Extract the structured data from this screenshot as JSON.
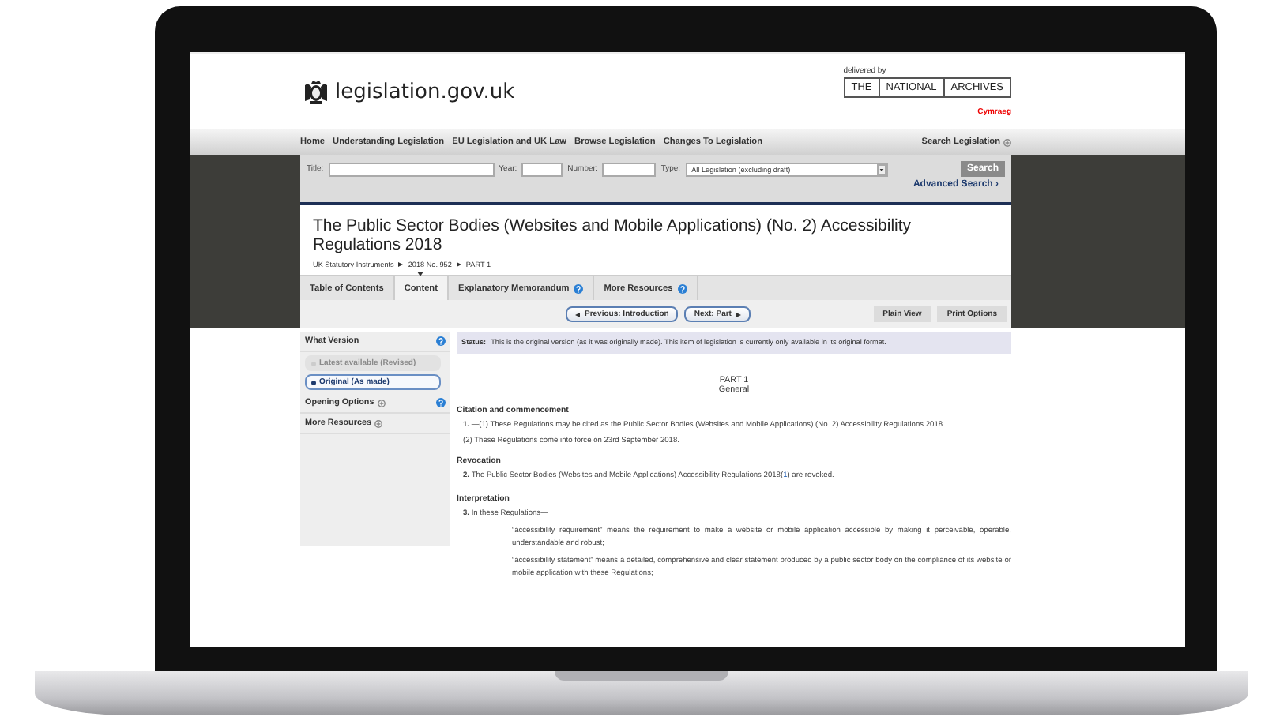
{
  "header": {
    "logo_text": "legislation.gov.uk",
    "delivered_by": "delivered by",
    "archives": [
      "THE",
      "NATIONAL",
      "ARCHIVES"
    ],
    "language_link": "Cymraeg"
  },
  "nav": {
    "items": [
      "Home",
      "Understanding Legislation",
      "EU Legislation and UK Law",
      "Browse Legislation",
      "Changes To Legislation"
    ],
    "search_toggle": "Search Legislation"
  },
  "search": {
    "fields": [
      {
        "label": "Title:",
        "kind": "wide"
      },
      {
        "label": "Year:",
        "kind": "short"
      },
      {
        "label": "Number:",
        "kind": "medium"
      }
    ],
    "type_label": "Type:",
    "type_value": "All Legislation (excluding draft)",
    "button": "Search",
    "advanced": "Advanced Search ›"
  },
  "document": {
    "title": "The Public Sector Bodies (Websites and Mobile Applications) (No. 2) Accessibility Regulations 2018",
    "breadcrumbs": [
      "UK Statutory Instruments",
      "2018 No. 952",
      "PART 1"
    ]
  },
  "tabs": [
    {
      "label": "Table of Contents",
      "selected": false,
      "help": false
    },
    {
      "label": "Content",
      "selected": true,
      "help": false
    },
    {
      "label": "Explanatory Memorandum",
      "selected": false,
      "help": true
    },
    {
      "label": "More Resources",
      "selected": false,
      "help": true
    }
  ],
  "pager": {
    "previous": "Previous: Introduction",
    "next": "Next: Part"
  },
  "view_buttons": [
    "Plain View",
    "Print Options"
  ],
  "sidebar": {
    "sections": [
      {
        "title": "What Version",
        "help": true,
        "expandable": false,
        "options": [
          {
            "label": "Latest available (Revised)",
            "disabled": true,
            "selected": false
          },
          {
            "label": "Original (As made)",
            "disabled": false,
            "selected": true
          }
        ]
      },
      {
        "title": "Opening Options",
        "help": true,
        "expandable": true
      },
      {
        "title": "More Resources",
        "help": false,
        "expandable": true
      }
    ]
  },
  "status": {
    "label": "Status:",
    "text": "This is the original version (as it was originally made). This item of legislation is currently only available in its original format."
  },
  "content": {
    "part": "PART 1",
    "part_title": "General",
    "blocks": [
      {
        "kind": "heading",
        "text": "Citation and commencement"
      },
      {
        "kind": "provision",
        "number": "1.",
        "text": "—(1) These Regulations may be cited as the Public Sector Bodies (Websites and Mobile Applications) (No. 2) Accessibility Regulations 2018."
      },
      {
        "kind": "subparagraph",
        "text": "(2) These Regulations come into force on 23rd September 2018."
      },
      {
        "kind": "heading",
        "text": "Revocation"
      },
      {
        "kind": "provision",
        "number": "2.",
        "text": "The Public Sector Bodies (Websites and Mobile Applications) Accessibility Regulations 2018(",
        "footnote": "1",
        "text_after": ") are revoked."
      },
      {
        "kind": "heading",
        "text": "Interpretation"
      },
      {
        "kind": "provision",
        "number": "3.",
        "text": "In these Regulations—"
      },
      {
        "kind": "definition",
        "text": "“accessibility requirement” means the requirement to make a website or mobile application accessible by making it perceivable, operable, understandable and robust;"
      },
      {
        "kind": "definition",
        "text": "“accessibility statement” means a detailed, comprehensive and clear statement produced by a public sector body on the compliance of its website or mobile application with these Regulations;"
      }
    ]
  }
}
